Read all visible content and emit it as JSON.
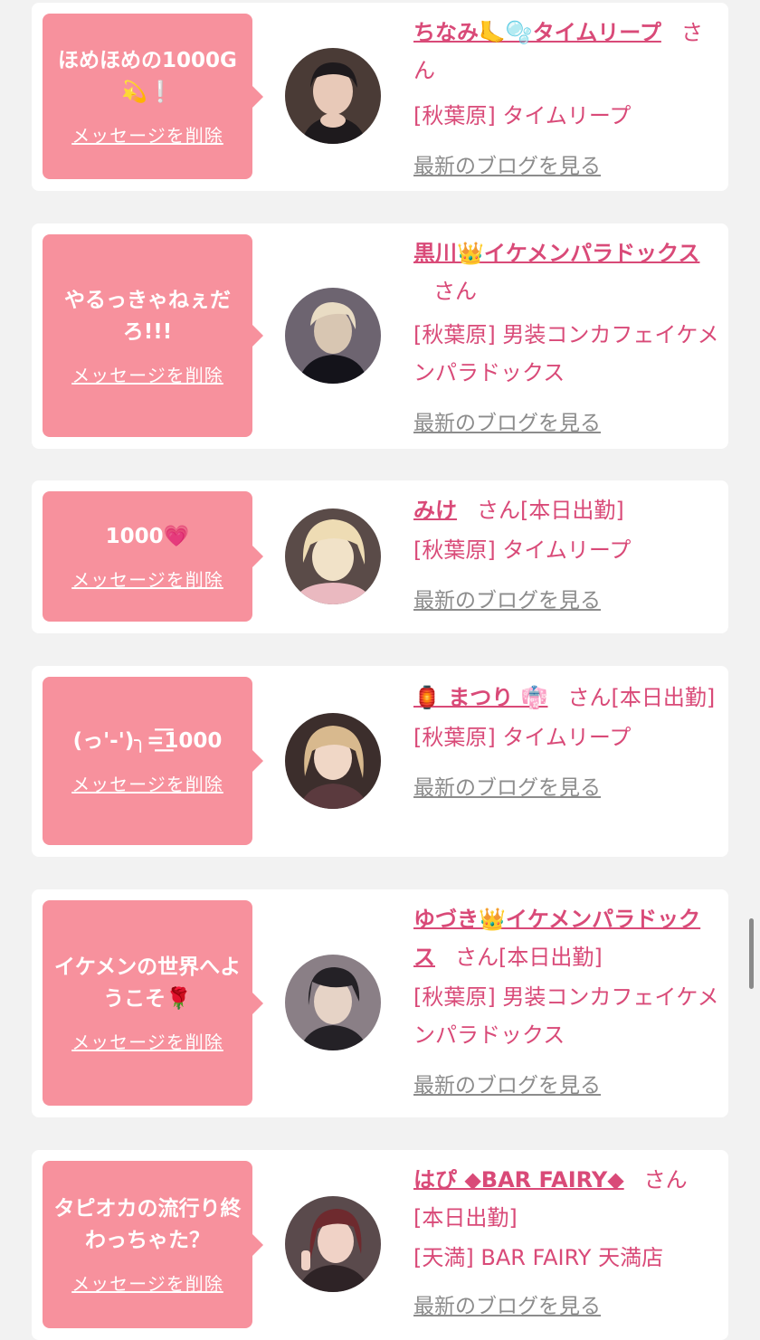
{
  "entries": [
    {
      "message": "ほめほめの1000G💫❕",
      "delete_label": "メッセージを削除",
      "name": "ちなみ🦶🫧タイムリープ",
      "san": "さん",
      "status": "",
      "shop": "[秋葉原] タイムリープ",
      "blog_label": "最新のブログを見る",
      "avatar_colors": [
        "#4a3b36",
        "#e8c9b8",
        "#1e1a1d"
      ]
    },
    {
      "message": "やるっきゃねぇだろ!!!",
      "delete_label": "メッセージを削除",
      "name": "黒川👑イケメンパラドックス",
      "san": "さん",
      "status": "",
      "shop": "[秋葉原] 男装コンカフェイケメンパラドックス",
      "blog_label": "最新のブログを見る",
      "avatar_colors": [
        "#6d6470",
        "#d8c6b2",
        "#14131a"
      ]
    },
    {
      "message": "1000💗",
      "delete_label": "メッセージを削除",
      "name": "みけ",
      "san": "さん",
      "status": "[本日出勤]",
      "shop": "[秋葉原] タイムリープ",
      "blog_label": "最新のブログを見る",
      "avatar_colors": [
        "#5a4b48",
        "#f1e2c8",
        "#eab9c0"
      ]
    },
    {
      "message": "(っ'-')╮=͟͟͞͞1000",
      "delete_label": "メッセージを削除",
      "name": "🏮 まつり 👘",
      "san": "さん",
      "status": "[本日出勤]",
      "shop": "[秋葉原] タイムリープ",
      "blog_label": "最新のブログを見る",
      "avatar_colors": [
        "#3c2e2c",
        "#d8b98e",
        "#5b3a3e"
      ]
    },
    {
      "message": "イケメンの世界へようこそ🌹",
      "delete_label": "メッセージを削除",
      "name": "ゆづき👑イケメンパラドックス",
      "san": "さん",
      "status": "[本日出勤]",
      "shop": "[秋葉原] 男装コンカフェイケメンパラドックス",
      "blog_label": "最新のブログを見る",
      "avatar_colors": [
        "#8a7f86",
        "#e6d3c6",
        "#242126"
      ]
    },
    {
      "message": "タピオカの流行り終わっちゃた？",
      "delete_label": "メッセージを削除",
      "name": "はぴ ◆BAR FAIRY◆",
      "san": "さん",
      "status": "[本日出勤]",
      "shop": "[天満] BAR FAIRY 天満店",
      "blog_label": "最新のブログを見る",
      "avatar_colors": [
        "#5a4a4c",
        "#f0d2c6",
        "#2e2326"
      ]
    }
  ]
}
